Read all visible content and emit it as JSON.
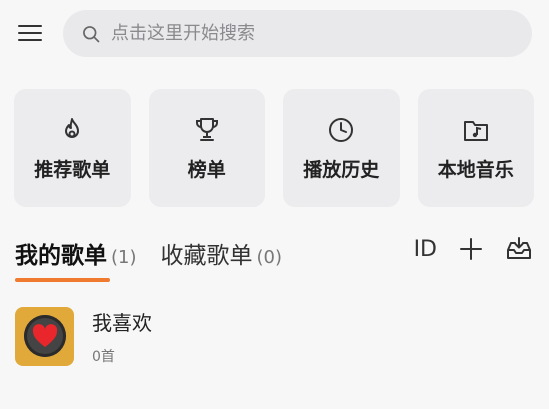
{
  "search": {
    "placeholder": "点击这里开始搜索"
  },
  "tiles": [
    {
      "label": "推荐歌单",
      "icon": "flame-icon"
    },
    {
      "label": "榜单",
      "icon": "trophy-icon"
    },
    {
      "label": "播放历史",
      "icon": "clock-icon"
    },
    {
      "label": "本地音乐",
      "icon": "music-folder-icon"
    }
  ],
  "tabs": [
    {
      "label": "我的歌单",
      "count": "(1)"
    },
    {
      "label": "收藏歌单",
      "count": "(0)"
    }
  ],
  "actions": {
    "id_label": "ID"
  },
  "playlists": [
    {
      "title": "我喜欢",
      "count": "0首"
    }
  ],
  "colors": {
    "accent": "#f07a30",
    "cover": "#e1a93a",
    "heart": "#e8262b"
  }
}
